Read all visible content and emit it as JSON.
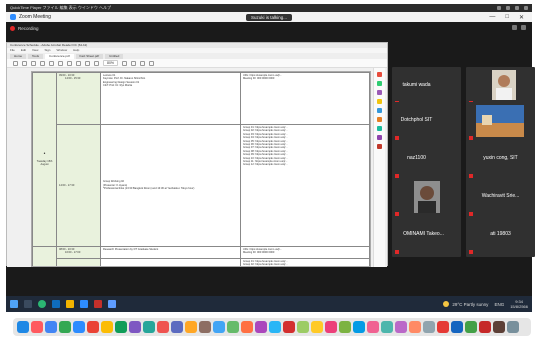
{
  "player": {
    "title": "QuickTime Player ファイル 編集 表示 ウインドウ ヘルプ"
  },
  "zoom": {
    "window_title": "Zoom Meeting",
    "recording_label": "Recording",
    "talking_banner": "Suzuki is talking...",
    "window_controls": [
      "—",
      "□",
      "✕"
    ]
  },
  "shared": {
    "doc_title": "Conference Schedule - Adobe Acrobat Reader DC (64-bit)",
    "menu": [
      "File",
      "Edit",
      "View",
      "Sign",
      "Window",
      "Help"
    ],
    "tabs": [
      "Home",
      "Tools",
      "Conference.pdf",
      "Fact Sheet.pdf",
      "Untitled"
    ],
    "zoom_value": "80%",
    "day_label": "Tuesday 15th August",
    "rows": [
      {
        "time": "09:00 - 10:30",
        "sub": "14:00 - 15:30",
        "session": [
          "Lecture 01",
          "Keynote: Prof. Dr. Nakano Shinichiro",
          "Engineering Design Session 01",
          "C&T: Prof. Dr. Ryo Morita"
        ],
        "links": [
          "URL: https://example.zoom.us/j/...",
          "Meeting ID: 000 0000 0000"
        ]
      },
      {
        "time": "14:00 - 17:30",
        "sub": "",
        "session": [
          "Group Working 02",
          "(Presenter: K.Ayano)",
          "*Professional links (13:30 Bangkok Room) and 13:30 at Yeohatsku: Tokyo hour)"
        ],
        "links": [
          "Group 01: https://example.zoom.us/j/...",
          "Group 02: https://example.zoom.us/j/...",
          "Group 03: https://example.zoom.us/j/...",
          "Group 04: https://example.zoom.us/j/...",
          "Group 05: https://example.zoom.us/j/...",
          "Group 06: https://example.zoom.us/j/...",
          "Group 07: https://example.zoom.us/j/...",
          "Group 08: https://example.zoom.us/j/...",
          "Group 09: https://example.zoom.us/j/...",
          "Group 10: https://example.zoom.us/j/...",
          "Group 11: https://example.zoom.us/j/...",
          "Group 12: https://example.zoom.us/j/..."
        ]
      },
      {
        "time": "08:00 - 10:30",
        "sub": "16:00 - 17:00",
        "session": [
          "Research Presentation by DT Graduate Student"
        ],
        "links": [
          "URL: https://example.zoom.us/j/...",
          "Meeting ID: 000 0000 0000"
        ]
      },
      {
        "time": "",
        "sub": "",
        "session": [],
        "links": [
          "Group 01: https://example.zoom.us/j/...",
          "Group 02: https://example.zoom.us/j/..."
        ]
      }
    ]
  },
  "participants": [
    {
      "name": "takumi wada",
      "has_photo": true
    },
    {
      "name": "Dotchphol SIT",
      "has_photo": true
    },
    {
      "name": "naz1100",
      "has_photo": false
    },
    {
      "name": "yuxin cong, SIT",
      "has_photo": false
    },
    {
      "name": "Haruka Takada",
      "has_photo": true
    },
    {
      "name": "Wachiravit Srie...",
      "has_photo": false
    },
    {
      "name": "OMINAMI Takeo...",
      "has_photo": false
    },
    {
      "name": "ati 19803",
      "has_photo": false
    }
  ],
  "taskbar": {
    "weather": "29°C Partly sunny",
    "language": "ENG",
    "time": "9:34",
    "date": "15/8/2566"
  },
  "colors": {
    "accent": "#2d8cff",
    "recording": "#e02828",
    "doc_green": "#e9f2dd"
  }
}
